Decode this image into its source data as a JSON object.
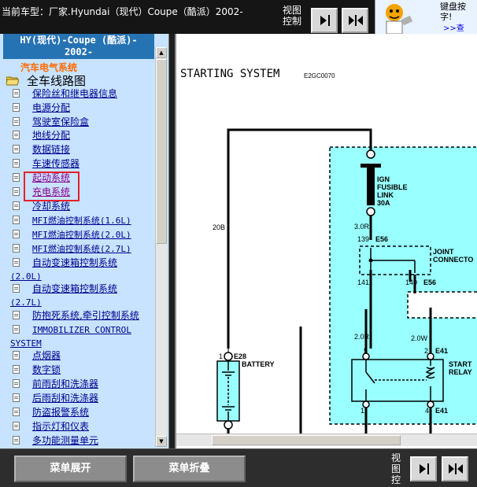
{
  "header": {
    "title": "当前车型：厂家.Hyundai（现代）Coupe（酷派）2002-",
    "view_control_label_1": "视图",
    "view_control_label_2": "控制"
  },
  "ad": {
    "text_line_1": "键盘按",
    "text_line_2": "字!",
    "link": ">>查"
  },
  "sidebar": {
    "heading_line_1": "HY(现代)-Coupe (酷派)-",
    "heading_line_2": "2002-",
    "subheading": "汽车电气系统",
    "root_label": "全车线路图",
    "items": [
      {
        "label": "保险丝和继电器信息"
      },
      {
        "label": "电源分配"
      },
      {
        "label": "驾驶室保险盒"
      },
      {
        "label": "地线分配"
      },
      {
        "label": "数据链接"
      },
      {
        "label": "车速传感器"
      },
      {
        "label": "起动系统"
      },
      {
        "label": "充电系统"
      },
      {
        "label": "冷却系统"
      },
      {
        "label": "MFI燃油控制系统(1.6L)"
      },
      {
        "label": "MFI燃油控制系统(2.0L)"
      },
      {
        "label": "MFI燃油控制系统(2.7L)"
      },
      {
        "label": "自动变速箱控制系统",
        "label_2": "(2.0L)"
      },
      {
        "label": "自动变速箱控制系统",
        "label_2": "(2.7L)"
      },
      {
        "label": "防抱死系统,牵引控制系统"
      },
      {
        "label": "IMMOBILIZER CONTROL",
        "label_2": "SYSTEM"
      },
      {
        "label": "点烟器"
      },
      {
        "label": "数字锁"
      },
      {
        "label": "前雨刮和洗涤器"
      },
      {
        "label": "后雨刮和洗涤器"
      },
      {
        "label": "防盗报警系统"
      },
      {
        "label": "指示灯和仪表"
      },
      {
        "label": "多功能测量单元"
      }
    ]
  },
  "diagram": {
    "title": "STARTING SYSTEM",
    "code": "E2GC0070",
    "fuse_label_1": "IGN",
    "fuse_label_2": "FUSIBLE",
    "fuse_label_3": "LINK",
    "fuse_label_4": "30A",
    "wire_30r": "3.0R",
    "wire_20b": "20B",
    "wire_20r": "2.0R",
    "wire_20w": "2.0W",
    "pin_139": "139",
    "connector_e56_top": "E56",
    "joint_label_1": "JOINT",
    "joint_label_2": "CONNECTO",
    "pin_141": "141",
    "pin_140": "140",
    "connector_e56_bottom": "E56",
    "battery_pin": "1",
    "battery_connector": "E28",
    "battery_label": "BATTERY",
    "relay_pin_5": "5",
    "relay_pin_2": "2",
    "relay_connector_top": "E41",
    "relay_label_1": "START",
    "relay_label_2": "RELAY",
    "relay_pin_1": "1",
    "relay_pin_4": "4",
    "relay_connector_bottom": "E41",
    "colors": {
      "shade": "#99ffff",
      "wire": "#000000"
    }
  },
  "footer": {
    "expand_menu": "菜单展开",
    "collapse_menu": "菜单折叠",
    "view_label": "视图控"
  }
}
